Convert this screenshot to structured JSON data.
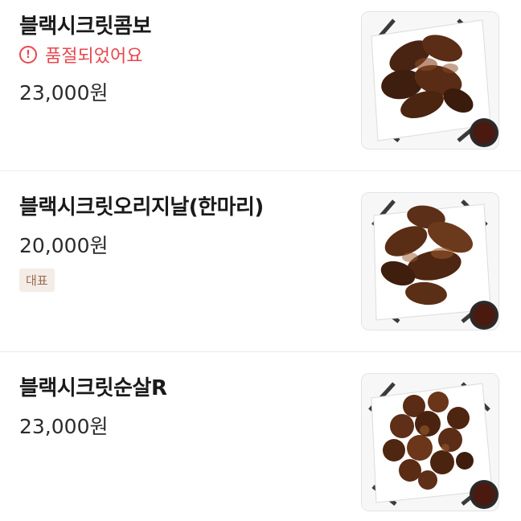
{
  "menu": {
    "items": [
      {
        "name": "블랙시크릿콤보",
        "status": "품절되었어요",
        "price": "23,000원",
        "image_icon": "fried-chicken-photo"
      },
      {
        "name": "블랙시크릿오리지날(한마리)",
        "price": "20,000원",
        "badge": "대표",
        "image_icon": "fried-chicken-photo"
      },
      {
        "name": "블랙시크릿순살R",
        "price": "23,000원",
        "image_icon": "fried-chicken-photo"
      }
    ]
  },
  "colors": {
    "soldout": "#e8484f",
    "badge_bg": "#f4ece6",
    "badge_text": "#9a6a52",
    "divider": "#ececec"
  }
}
